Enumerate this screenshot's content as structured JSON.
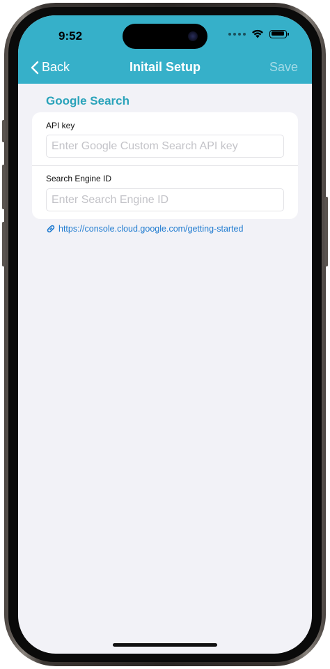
{
  "status_bar": {
    "time": "9:52"
  },
  "nav": {
    "back_label": "Back",
    "title": "Initail Setup",
    "save_label": "Save"
  },
  "section": {
    "title": "Google Search"
  },
  "form": {
    "api_key_label": "API key",
    "api_key_placeholder": "Enter Google Custom Search API key",
    "api_key_value": "",
    "engine_id_label": "Search Engine ID",
    "engine_id_placeholder": "Enter Search Engine ID",
    "engine_id_value": ""
  },
  "link": {
    "icon": "link-icon",
    "text": "https://console.cloud.google.com/getting-started"
  },
  "colors": {
    "header_bg": "#36b0c9",
    "accent": "#2aa3ba",
    "link": "#1f7bd0",
    "screen_bg": "#f2f2f7"
  }
}
